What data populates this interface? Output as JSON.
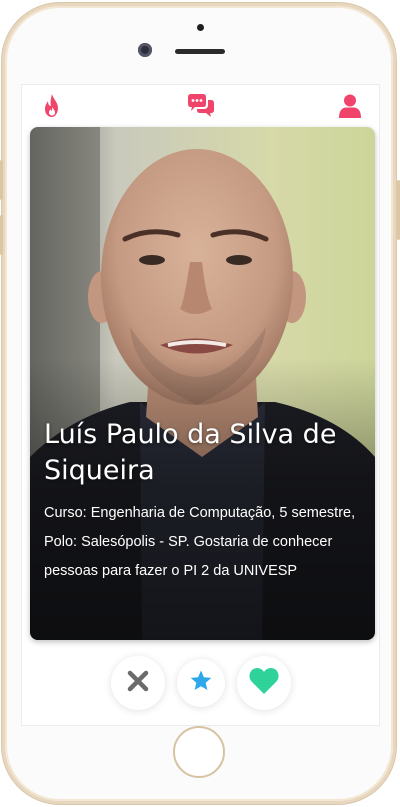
{
  "topbar": {
    "left_icon": "flame-icon",
    "center_icon": "chat-bubbles-icon",
    "right_icon": "user-icon",
    "accent_color": "#f0446b"
  },
  "profile": {
    "name": "Luís Paulo da Silva de Siqueira",
    "bio": "Curso: Engenharia de Computação, 5 semestre, Polo: Salesópolis - SP. Gostaria de conhecer pessoas para fazer o PI 2 da UNIVESP"
  },
  "actions": {
    "dislike_icon": "close-icon",
    "superlike_icon": "star-icon",
    "like_icon": "heart-icon",
    "dislike_color": "#6b6b6b",
    "superlike_color": "#2ea8ea",
    "like_color": "#2fd39a"
  }
}
